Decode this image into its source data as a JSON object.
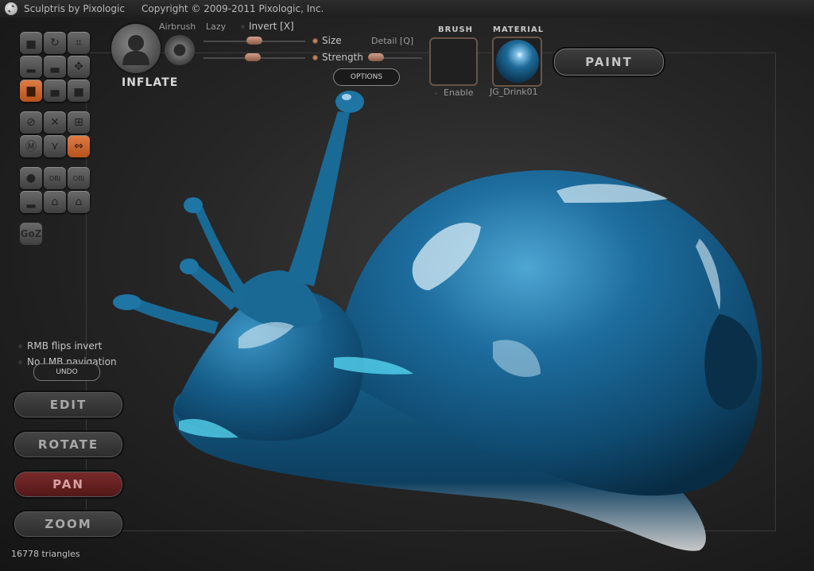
{
  "app": {
    "title": "Sculptris by Pixologic",
    "copyright": "Copyright © 2009-2011 Pixologic, Inc."
  },
  "brush_panel": {
    "tool_name": "INFLATE",
    "airbrush_label": "Airbrush",
    "lazy_label": "Lazy",
    "invert_label": "Invert [X]",
    "size_label": "Size",
    "strength_label": "Strength",
    "detail_label": "Detail [Q]",
    "options_label": "OPTIONS"
  },
  "brush_section": {
    "header": "BRUSH",
    "enable_label": "Enable"
  },
  "material_section": {
    "header": "MATERIAL",
    "material_name": "JG_Drink01"
  },
  "paint_button": "PAINT",
  "options": {
    "rmb_flips_invert": "RMB flips invert",
    "no_lmb_navigation": "No LMB navigation"
  },
  "undo_label": "UNDO",
  "nav_buttons": {
    "edit": "EDIT",
    "rotate": "ROTATE",
    "pan": "PAN",
    "zoom": "ZOOM"
  },
  "goz_label": "GoZ",
  "stats": {
    "triangles": "16778 triangles"
  },
  "tools": [
    {
      "name": "draw-tool-icon",
      "glyph": "▅"
    },
    {
      "name": "rotate-tool-icon",
      "glyph": "↻"
    },
    {
      "name": "crop-tool-icon",
      "glyph": "⌗"
    },
    {
      "name": "flatten-tool-icon",
      "glyph": "▂"
    },
    {
      "name": "crease-tool-icon",
      "glyph": "▃"
    },
    {
      "name": "grab-move-icon",
      "glyph": "✥"
    },
    {
      "name": "inflate-tool-icon",
      "glyph": "▆"
    },
    {
      "name": "pinch-tool-icon",
      "glyph": "▄"
    },
    {
      "name": "smooth-tool-icon",
      "glyph": "▅"
    },
    {
      "name": "reduce-tool-icon",
      "glyph": "⊘"
    },
    {
      "name": "mask-tool-icon",
      "glyph": "✕"
    },
    {
      "name": "grid-tool-icon",
      "glyph": "⊞"
    },
    {
      "name": "symmetry-tool-icon",
      "glyph": "Ⓜ"
    },
    {
      "name": "wireframe-tool-icon",
      "glyph": "⋎"
    },
    {
      "name": "mirror-tool-icon",
      "glyph": "⇔"
    },
    {
      "name": "sphere-tool-icon",
      "glyph": "●"
    },
    {
      "name": "import-obj-icon",
      "glyph": "OBJ"
    },
    {
      "name": "export-obj-icon",
      "glyph": "OBJ"
    },
    {
      "name": "plane-tool-icon",
      "glyph": "▂"
    },
    {
      "name": "open-file-icon",
      "glyph": "⌂"
    },
    {
      "name": "save-file-icon",
      "glyph": "⌂"
    }
  ],
  "colors": {
    "active_tool": "#c96530",
    "pan_button": "#6a2222",
    "material": "#1e6a98"
  }
}
